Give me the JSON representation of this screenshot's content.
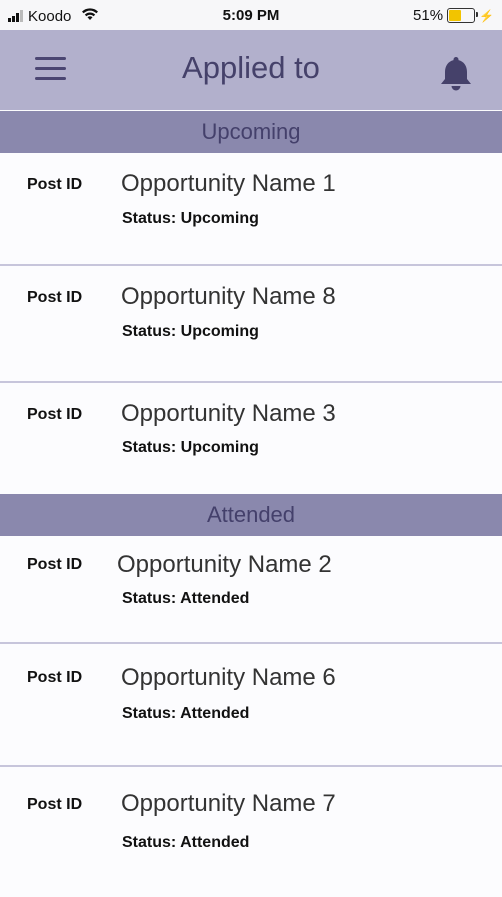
{
  "status_bar": {
    "carrier": "Koodo",
    "time": "5:09 PM",
    "battery_percent": "51%",
    "battery_level": 0.51,
    "icons": [
      "signal-icon",
      "wifi-icon",
      "battery-icon",
      "charging-icon"
    ]
  },
  "header": {
    "title": "Applied to",
    "menu_icon": "hamburger-menu-icon",
    "notification_icon": "bell-icon"
  },
  "sections": [
    {
      "title": "Upcoming",
      "items": [
        {
          "post_id": "Post ID",
          "name": "Opportunity Name 1",
          "status": "Status: Upcoming"
        },
        {
          "post_id": "Post ID",
          "name": "Opportunity Name 8",
          "status": "Status: Upcoming"
        },
        {
          "post_id": "Post ID",
          "name": "Opportunity Name 3",
          "status": "Status: Upcoming"
        }
      ]
    },
    {
      "title": "Attended",
      "items": [
        {
          "post_id": "Post ID",
          "name": "Opportunity Name 2",
          "status": "Status: Attended"
        },
        {
          "post_id": "Post ID",
          "name": "Opportunity Name 6",
          "status": "Status: Attended"
        },
        {
          "post_id": "Post ID",
          "name": "Opportunity Name 7",
          "status": "Status: Attended"
        }
      ]
    }
  ],
  "colors": {
    "header_bg": "#b2b0cc",
    "section_bg": "#8a88ad",
    "title_text": "#45416a",
    "divider": "#c7c5db"
  }
}
